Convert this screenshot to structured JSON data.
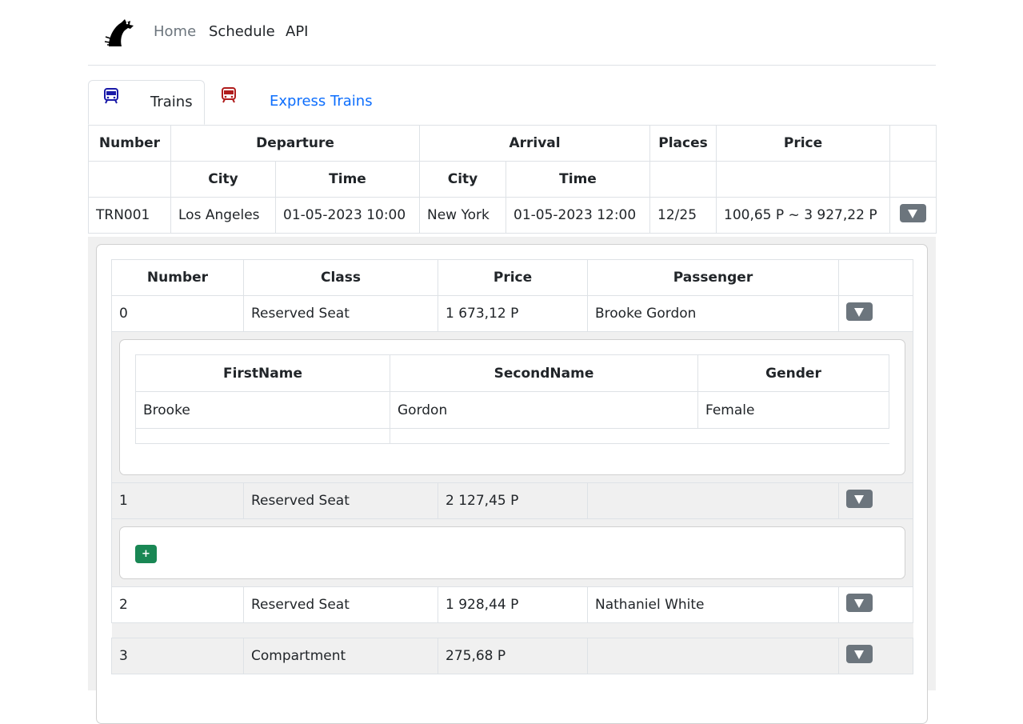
{
  "nav": {
    "home": "Home",
    "schedule": "Schedule",
    "api": "API"
  },
  "tabs": [
    {
      "label": "Trains",
      "icon": "train-icon",
      "color": "#1a1aa8"
    },
    {
      "label": "Express Trains",
      "icon": "train-icon",
      "color": "#b01c1c"
    }
  ],
  "table": {
    "headers": {
      "number": "Number",
      "departure": "Departure",
      "arrival": "Arrival",
      "places": "Places",
      "price": "Price",
      "city": "City",
      "time": "Time"
    },
    "row": {
      "number": "TRN001",
      "dep_city": "Los Angeles",
      "dep_time": "01-05-2023 10:00",
      "arr_city": "New York",
      "arr_time": "01-05-2023 12:00",
      "places": "12/25",
      "price": "100,65 Р ~ 3 927,22 Р"
    }
  },
  "tickets": {
    "headers": {
      "number": "Number",
      "class": "Class",
      "price": "Price",
      "passenger": "Passenger"
    },
    "rows": [
      {
        "number": "0",
        "class": "Reserved Seat",
        "price": "1 673,12 Р",
        "passenger": "Brooke Gordon"
      },
      {
        "number": "1",
        "class": "Reserved Seat",
        "price": "2 127,45 Р",
        "passenger": ""
      },
      {
        "number": "2",
        "class": "Reserved Seat",
        "price": "1 928,44 Р",
        "passenger": "Nathaniel White"
      },
      {
        "number": "3",
        "class": "Compartment",
        "price": "275,68 Р",
        "passenger": ""
      }
    ]
  },
  "passenger": {
    "headers": {
      "first": "FirstName",
      "second": "SecondName",
      "gender": "Gender"
    },
    "first": "Brooke",
    "second": "Gordon",
    "gender": "Female"
  },
  "add_button": "+"
}
